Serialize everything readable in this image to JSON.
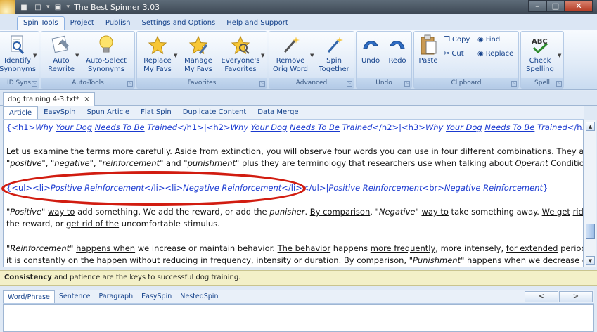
{
  "window": {
    "title": "The Best Spinner 3.03",
    "min_symbol": "–",
    "max_symbol": "□",
    "close_symbol": "✕"
  },
  "ribbon_tabs": [
    "Spin Tools",
    "Project",
    "Publish",
    "Settings and Options",
    "Help and Support"
  ],
  "ribbon": {
    "groups": {
      "id_syns": "ID Syns",
      "auto_tools": "Auto-Tools",
      "favorites": "Favorites",
      "advanced": "Advanced",
      "undo": "Undo",
      "clipboard": "Clipboard",
      "spell": "Spell"
    },
    "buttons": {
      "identify": "Identify\nSynonyms",
      "auto_rewrite": "Auto\nRewrite",
      "auto_select": "Auto-Select\nSynonyms",
      "replace_favs": "Replace\nMy Favs",
      "manage_favs": "Manage\nMy Favs",
      "everyones_favs": "Everyone's\nFavorites",
      "remove_orig": "Remove\nOrig Word",
      "spin_together": "Spin\nTogether",
      "undo": "Undo",
      "redo": "Redo",
      "paste": "Paste",
      "copy": "Copy",
      "cut": "Cut",
      "find": "Find",
      "replace": "Replace",
      "check_spelling": "Check\nSpelling"
    }
  },
  "document_tab": {
    "name": "dog training 4-3.txt*",
    "close": "×"
  },
  "sub_tabs": [
    "Article",
    "EasySpin",
    "Spun Article",
    "Flat Spin",
    "Duplicate Content",
    "Data Merge"
  ],
  "bottom_tabs": [
    "Word/Phrase",
    "Sentence",
    "Paragraph",
    "EasySpin",
    "NestedSpin"
  ],
  "tip": {
    "bold": "Consistency",
    "rest": " and patience are the keys to successful dog training."
  },
  "nav": {
    "prev": "<",
    "next": ">"
  }
}
